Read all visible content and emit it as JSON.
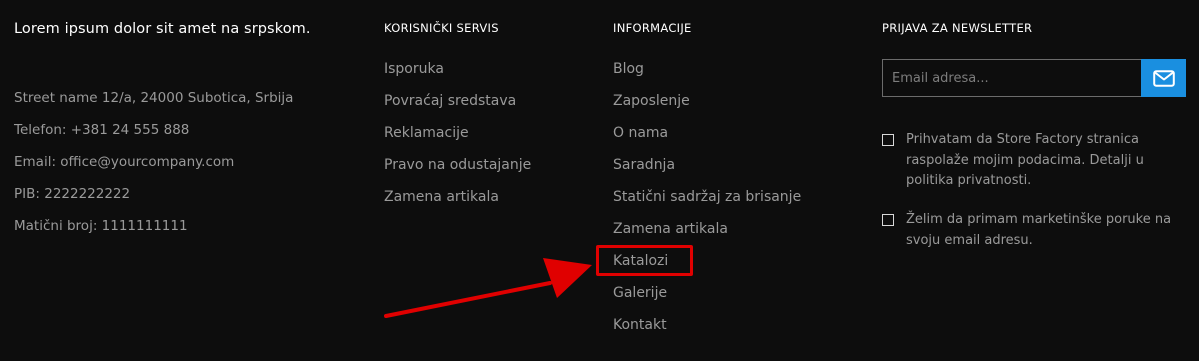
{
  "company": {
    "tagline": "Lorem ipsum dolor sit amet na srpskom.",
    "contact": [
      "Street name 12/a, 24000 Subotica, Srbija",
      "Telefon: +381 24 555 888",
      "Email: office@yourcompany.com",
      "PIB: 2222222222",
      "Matični broj: 1111111111"
    ]
  },
  "customer_service": {
    "heading": "KORISNIČKI SERVIS",
    "links": [
      "Isporuka",
      "Povraćaj sredstava",
      "Reklamacije",
      "Pravo na odustajanje",
      "Zamena artikala"
    ]
  },
  "information": {
    "heading": "INFORMACIJE",
    "links": [
      "Blog",
      "Zaposlenje",
      "O nama",
      "Saradnja",
      "Statični sadržaj za brisanje",
      "Zamena artikala",
      "Katalozi",
      "Galerije",
      "Kontakt"
    ]
  },
  "newsletter": {
    "heading": "PRIJAVA ZA NEWSLETTER",
    "email_placeholder": "Email adresa...",
    "submit_icon": "envelope-icon",
    "consents": [
      "Prihvatam da Store Factory stranica raspolaže mojim podacima. Detalji u politika privatnosti.",
      "Želim da primam marketinške poruke na svoju email adresu."
    ]
  },
  "annotation": {
    "highlight_color": "#e00000"
  },
  "colors": {
    "background": "#0d0d0d",
    "heading": "#ffffff",
    "muted_text": "#9a9a9a",
    "accent": "#1a8fe0"
  }
}
